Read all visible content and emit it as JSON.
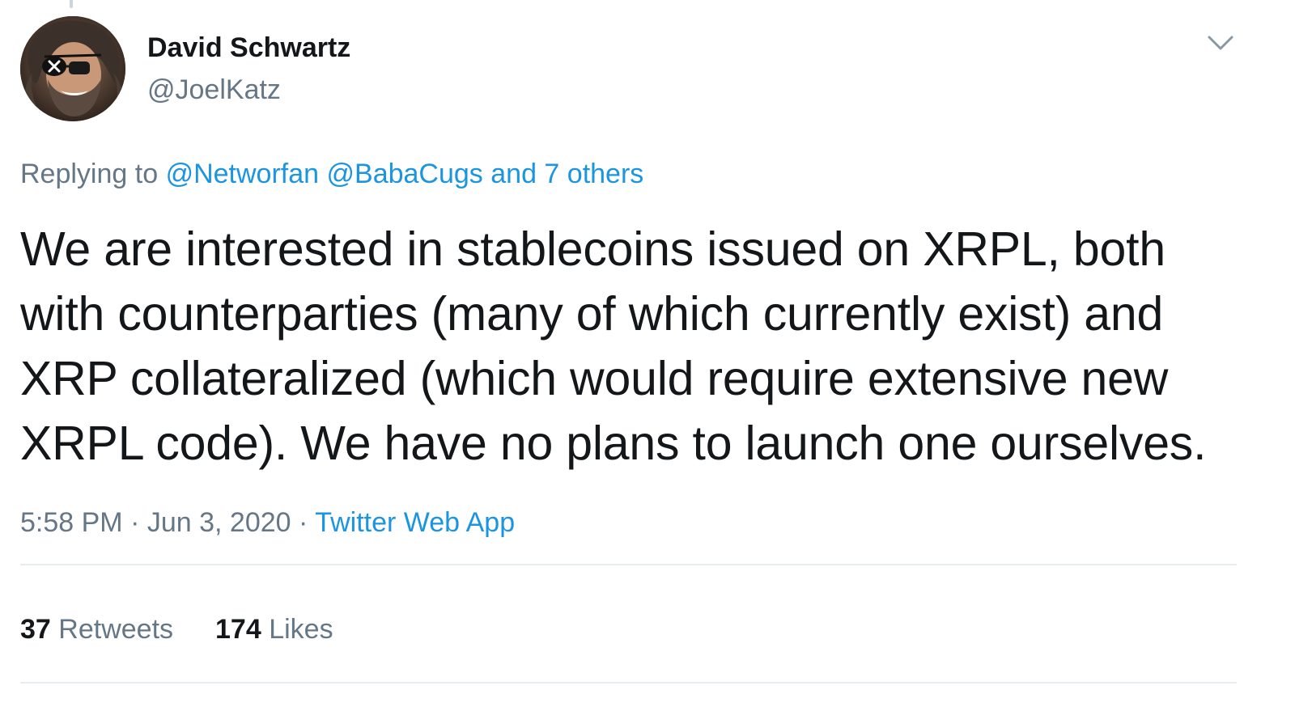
{
  "author": {
    "name": "David Schwartz",
    "handle": "@JoelKatz",
    "avatar_icon": "profile-photo"
  },
  "menu": {
    "icon": "chevron-down-icon"
  },
  "reply": {
    "prefix": "Replying to",
    "mentions": [
      "@Networfan",
      "@BabaCugs"
    ],
    "others": "and 7 others"
  },
  "tweet": {
    "lines": [
      "We are interested in stablecoins issued on XRPL, both",
      "with counterparties (many of which currently exist) and",
      "XRP collateralized (which would require extensive new",
      "XRPL code). We have no plans to launch one ourselves."
    ]
  },
  "meta": {
    "time": "5:58 PM",
    "separator": "·",
    "date": "Jun 3, 2020",
    "source": "Twitter Web App"
  },
  "stats": {
    "retweets_count": "37",
    "retweets_label": "Retweets",
    "likes_count": "174",
    "likes_label": "Likes"
  },
  "colors": {
    "text": "#14171a",
    "secondary": "#657786",
    "link": "#1b95e0",
    "divider": "#e6ecf0"
  }
}
